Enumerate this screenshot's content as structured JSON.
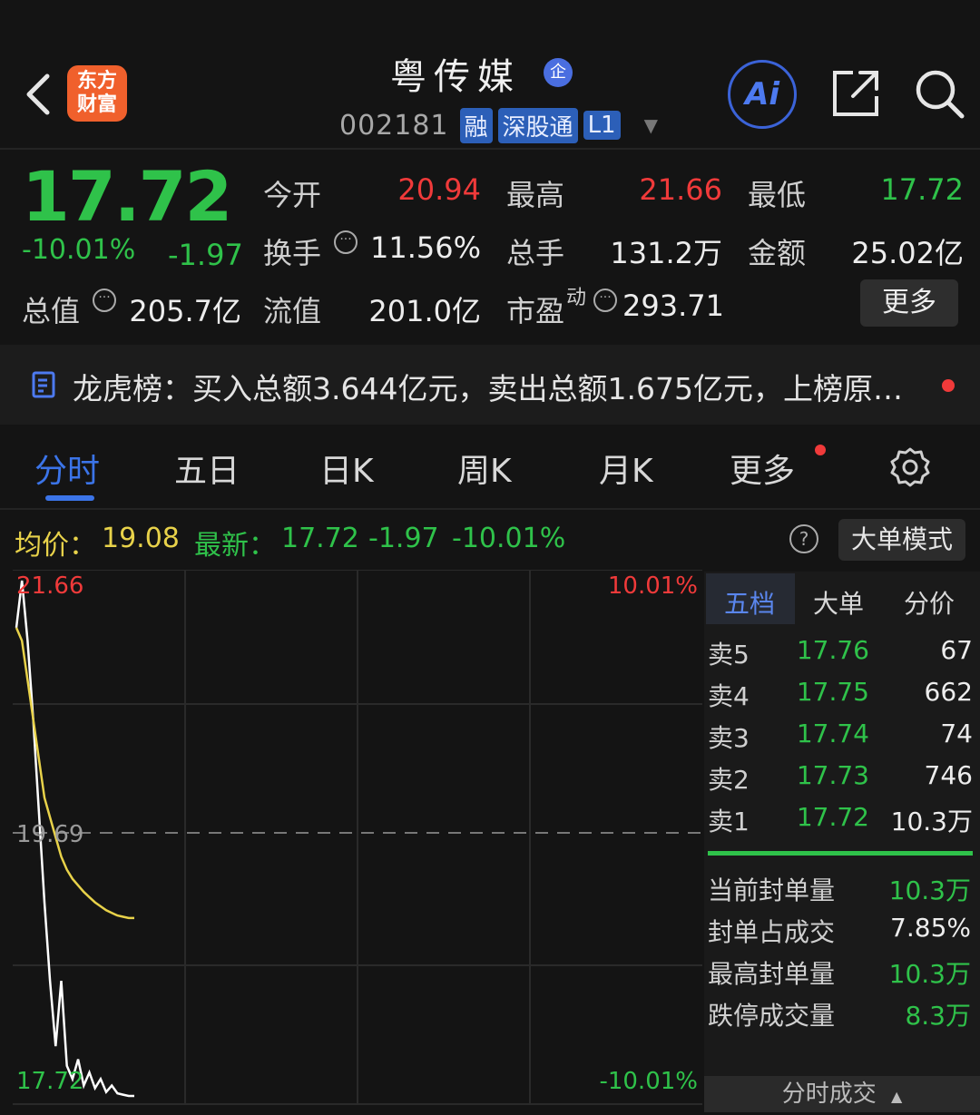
{
  "header": {
    "logo_line1": "东方",
    "logo_line2": "财富",
    "stock_name": "粤传媒",
    "enterprise_badge": "企",
    "code": "002181",
    "tags": [
      "融",
      "深股通",
      "L1"
    ],
    "ai_label": "Ai"
  },
  "quote": {
    "price": "17.72",
    "change_pct": "-10.01%",
    "change": "-1.97",
    "open_label": "今开",
    "open": "20.94",
    "high_label": "最高",
    "high": "21.66",
    "low_label": "最低",
    "low": "17.72",
    "turnover_label": "换手",
    "turnover": "11.56%",
    "volume_label": "总手",
    "volume": "131.2万",
    "amount_label": "金额",
    "amount": "25.02亿",
    "mktcap_label": "总值",
    "mktcap": "205.7亿",
    "float_label": "流值",
    "float_cap": "201.0亿",
    "pe_label": "市盈",
    "pe_sup": "动",
    "pe": "293.71",
    "more": "更多"
  },
  "longhu": {
    "text": "龙虎榜：买入总额3.644亿元，卖出总额1.675亿元，上榜原…"
  },
  "tabs": [
    "分时",
    "五日",
    "日K",
    "周K",
    "月K",
    "更多"
  ],
  "summary": {
    "avg_label": "均价：",
    "avg": "19.08",
    "latest_label": "最新：",
    "latest": "17.72",
    "change": "-1.97",
    "change_pct": "-10.01%",
    "help": "?",
    "big_order_mode": "大单模式"
  },
  "chart_data": {
    "type": "line",
    "y_labels": {
      "top": "21.66",
      "mid": "19.69",
      "bottom": "17.72"
    },
    "pct_labels": {
      "top": "10.01%",
      "bottom": "-10.01%"
    },
    "ylim": [
      17.72,
      21.66
    ],
    "series": [
      {
        "color": "#ffffff",
        "values": [
          21.3,
          21.66,
          21.2,
          20.6,
          19.9,
          19.2,
          18.6,
          18.1,
          18.6,
          17.95,
          17.85,
          18.0,
          17.8,
          17.9,
          17.78,
          17.85,
          17.75,
          17.8,
          17.74,
          17.73,
          17.72,
          17.72
        ]
      },
      {
        "color": "#e8d24a",
        "values": [
          21.3,
          21.2,
          20.9,
          20.6,
          20.3,
          20.0,
          19.85,
          19.7,
          19.55,
          19.45,
          19.38,
          19.33,
          19.28,
          19.24,
          19.2,
          19.17,
          19.14,
          19.12,
          19.1,
          19.09,
          19.08,
          19.08
        ]
      }
    ]
  },
  "order_book": {
    "tabs": [
      "五档",
      "大单",
      "分价"
    ],
    "asks": [
      {
        "label": "卖5",
        "price": "17.76",
        "volume": "67"
      },
      {
        "label": "卖4",
        "price": "17.75",
        "volume": "662"
      },
      {
        "label": "卖3",
        "price": "17.74",
        "volume": "74"
      },
      {
        "label": "卖2",
        "price": "17.73",
        "volume": "746"
      },
      {
        "label": "卖1",
        "price": "17.72",
        "volume": "10.3万"
      }
    ],
    "stats": [
      {
        "label": "当前封单量",
        "value": "10.3万",
        "color": "#2fc24a"
      },
      {
        "label": "封单占成交",
        "value": "7.85%",
        "color": "#ededed"
      },
      {
        "label": "最高封单量",
        "value": "10.3万",
        "color": "#2fc24a"
      },
      {
        "label": "跌停成交量",
        "value": "8.3万",
        "color": "#2fc24a"
      }
    ],
    "bottom_tab": "分时成交"
  }
}
